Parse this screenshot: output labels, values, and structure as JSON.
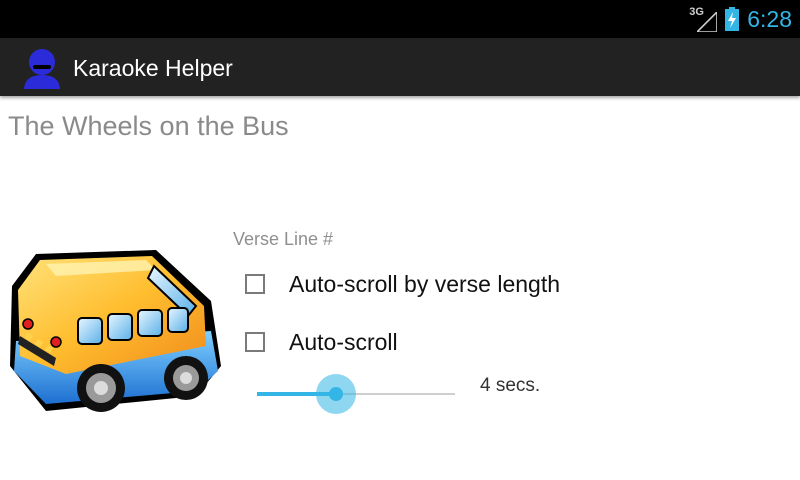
{
  "status_bar": {
    "network_type": "3G",
    "time": "6:28"
  },
  "action_bar": {
    "title": "Karaoke Helper",
    "icon": "person-icon"
  },
  "song": {
    "title": "The Wheels on the Bus",
    "image": "school-bus-image"
  },
  "controls": {
    "verse_line_label": "Verse Line #",
    "auto_scroll_verse": {
      "label": "Auto-scroll by verse length",
      "checked": false
    },
    "auto_scroll": {
      "label": "Auto-scroll",
      "checked": false
    },
    "scroll_delay": {
      "value_label": "4 secs.",
      "level": 0.4
    }
  },
  "colors": {
    "accent": "#33b5e5",
    "action_bar": "#222222",
    "app_icon": "#2b2bd9"
  }
}
